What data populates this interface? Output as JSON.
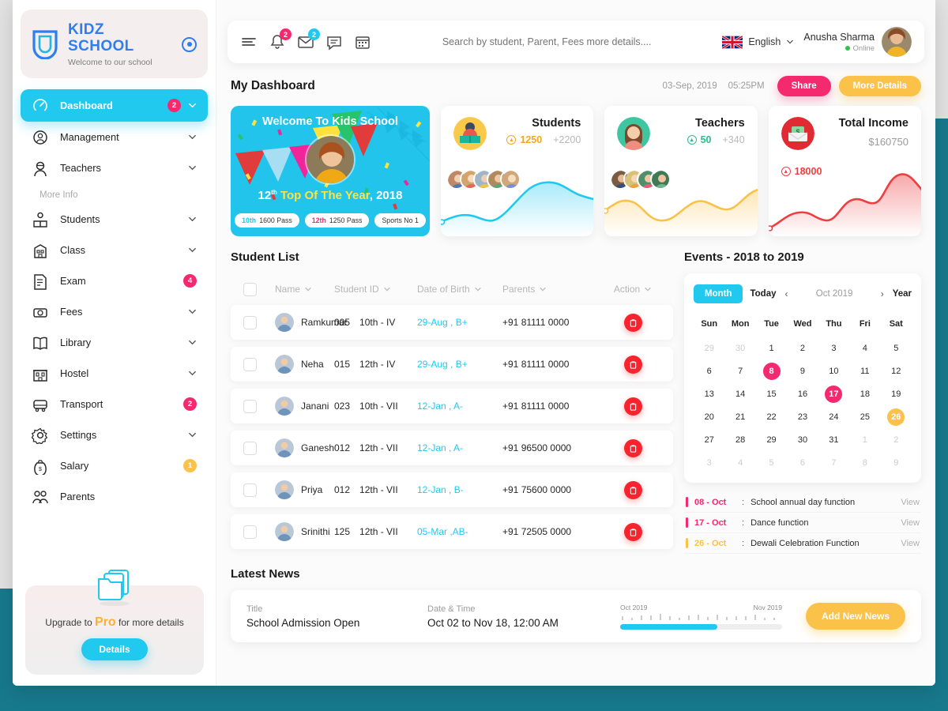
{
  "brand": {
    "title": "KIDZ SCHOOL",
    "subtitle": "Welcome to our school"
  },
  "sidebar": {
    "section_label": "More Info",
    "items": [
      {
        "label": "Dashboard",
        "icon": "speedometer-icon",
        "badge": "2",
        "badge_color": "pink",
        "chevron": true,
        "active": true
      },
      {
        "label": "Management",
        "icon": "gear-user-icon",
        "badge": "",
        "badge_color": "",
        "chevron": true,
        "active": false
      },
      {
        "label": "Teachers",
        "icon": "teacher-icon",
        "badge": "",
        "badge_color": "",
        "chevron": true,
        "active": false
      },
      {
        "label": "Students",
        "icon": "student-icon",
        "badge": "",
        "badge_color": "",
        "chevron": true,
        "active": false
      },
      {
        "label": "Class",
        "icon": "school-icon",
        "badge": "",
        "badge_color": "",
        "chevron": true,
        "active": false
      },
      {
        "label": "Exam",
        "icon": "exam-paper-icon",
        "badge": "4",
        "badge_color": "pink",
        "chevron": false,
        "active": false
      },
      {
        "label": "Fees",
        "icon": "fees-icon",
        "badge": "",
        "badge_color": "",
        "chevron": true,
        "active": false
      },
      {
        "label": "Library",
        "icon": "book-icon",
        "badge": "",
        "badge_color": "",
        "chevron": true,
        "active": false
      },
      {
        "label": "Hostel",
        "icon": "hostel-icon",
        "badge": "",
        "badge_color": "",
        "chevron": true,
        "active": false
      },
      {
        "label": "Transport",
        "icon": "bus-icon",
        "badge": "2",
        "badge_color": "pink",
        "chevron": false,
        "active": false
      },
      {
        "label": "Settings",
        "icon": "gear-icon",
        "badge": "",
        "badge_color": "",
        "chevron": true,
        "active": false
      },
      {
        "label": "Salary",
        "icon": "money-bag-icon",
        "badge": "1",
        "badge_color": "yellow",
        "chevron": false,
        "active": false
      },
      {
        "label": "Parents",
        "icon": "parents-icon",
        "badge": "",
        "badge_color": "",
        "chevron": false,
        "active": false
      }
    ],
    "promo": {
      "icon": "folder-documents-icon",
      "text_before": "Upgrade to ",
      "highlight": "Pro",
      "text_after": " for more details",
      "button": "Details"
    }
  },
  "topbar": {
    "icons": [
      {
        "name": "hamburger-menu-icon",
        "badge": "",
        "badge_color": ""
      },
      {
        "name": "bell-icon",
        "badge": "2",
        "badge_color": "pink"
      },
      {
        "name": "envelope-icon",
        "badge": "2",
        "badge_color": "cyan"
      },
      {
        "name": "chat-icon",
        "badge": "",
        "badge_color": ""
      },
      {
        "name": "calendar-icon",
        "badge": "",
        "badge_color": ""
      }
    ],
    "search": {
      "placeholder": "Search by student, Parent, Fees more details....",
      "value": ""
    },
    "language": {
      "label": "English",
      "flag": "uk-flag-icon"
    },
    "user": {
      "name": "Anusha Sharma",
      "status": "Online"
    }
  },
  "dashboard_header": {
    "title": "My Dashboard",
    "date": "03-Sep, 2019",
    "time": "05:25PM",
    "share_label": "Share",
    "more_label": "More Details"
  },
  "banner": {
    "title": "Welcome To Kids School",
    "rank": "12",
    "rank_sup": "th",
    "year_text": "Top Of The Year",
    "year": ", 2018",
    "pills": [
      {
        "tag": "10th",
        "text": "1600 Pass",
        "color": "cyan"
      },
      {
        "tag": "12th",
        "text": "1250 Pass",
        "color": "pink"
      },
      {
        "tag": "",
        "text": "Sports No 1",
        "color": ""
      }
    ]
  },
  "stats": [
    {
      "name": "Students",
      "value": "1250",
      "change": "+2200",
      "value_color": "#f5a623",
      "accent": "#22c9ef",
      "icon": "student-reading-icon"
    },
    {
      "name": "Teachers",
      "value": "50",
      "change": "+340",
      "value_color": "#2bbd8c",
      "accent": "#fbc24a",
      "icon": "teacher-woman-icon"
    }
  ],
  "income": {
    "name": "Total Income",
    "amount": "$160750",
    "value": "18000",
    "accent": "#ef3e42",
    "icon": "money-envelope-icon"
  },
  "student_list": {
    "title": "Student List",
    "columns": [
      "Name",
      "Student ID",
      "Date of Birth",
      "Parents",
      "Action"
    ],
    "rows": [
      {
        "name": "Ramkumar",
        "id": "005",
        "class": "10th - IV",
        "dob": "29-Aug , B+",
        "parents": "+91 81111 0000"
      },
      {
        "name": "Neha",
        "id": "015",
        "class": "12th - IV",
        "dob": "29-Aug , B+",
        "parents": "+91 81111 0000"
      },
      {
        "name": "Janani",
        "id": "023",
        "class": "10th - VII",
        "dob": "12-Jan , A-",
        "parents": "+91 81111 0000"
      },
      {
        "name": "Ganesh",
        "id": "012",
        "class": "12th - VII",
        "dob": "12-Jan , A-",
        "parents": "+91 96500 0000"
      },
      {
        "name": "Priya",
        "id": "012",
        "class": "12th - VII",
        "dob": "12-Jan , B-",
        "parents": "+91 75600 0000"
      },
      {
        "name": "Srinithi",
        "id": "125",
        "class": "12th - VII",
        "dob": "05-Mar ,AB-",
        "parents": "+91 72505 0000"
      }
    ]
  },
  "events_panel": {
    "title": "Events  - 2018 to 2019",
    "calendar": {
      "month_btn": "Month",
      "today_btn": "Today",
      "prev": "‹",
      "next": "›",
      "label": "Oct 2019",
      "year_btn": "Year",
      "dow": [
        "Sun",
        "Mon",
        "Tue",
        "Wed",
        "Thu",
        "Fri",
        "Sat"
      ],
      "weeks": [
        [
          {
            "d": "29",
            "s": "muted"
          },
          {
            "d": "30",
            "s": "muted"
          },
          {
            "d": "1",
            "s": ""
          },
          {
            "d": "2",
            "s": ""
          },
          {
            "d": "3",
            "s": ""
          },
          {
            "d": "4",
            "s": ""
          },
          {
            "d": "5",
            "s": ""
          }
        ],
        [
          {
            "d": "6",
            "s": ""
          },
          {
            "d": "7",
            "s": ""
          },
          {
            "d": "8",
            "s": "pink"
          },
          {
            "d": "9",
            "s": ""
          },
          {
            "d": "10",
            "s": ""
          },
          {
            "d": "11",
            "s": ""
          },
          {
            "d": "12",
            "s": ""
          }
        ],
        [
          {
            "d": "13",
            "s": ""
          },
          {
            "d": "14",
            "s": ""
          },
          {
            "d": "15",
            "s": ""
          },
          {
            "d": "16",
            "s": ""
          },
          {
            "d": "17",
            "s": "pink"
          },
          {
            "d": "18",
            "s": ""
          },
          {
            "d": "19",
            "s": ""
          }
        ],
        [
          {
            "d": "20",
            "s": ""
          },
          {
            "d": "21",
            "s": ""
          },
          {
            "d": "22",
            "s": ""
          },
          {
            "d": "23",
            "s": ""
          },
          {
            "d": "24",
            "s": ""
          },
          {
            "d": "25",
            "s": ""
          },
          {
            "d": "26",
            "s": "yellow"
          }
        ],
        [
          {
            "d": "27",
            "s": ""
          },
          {
            "d": "28",
            "s": ""
          },
          {
            "d": "29",
            "s": ""
          },
          {
            "d": "30",
            "s": ""
          },
          {
            "d": "31",
            "s": ""
          },
          {
            "d": "1",
            "s": "muted"
          },
          {
            "d": "2",
            "s": "muted"
          }
        ],
        [
          {
            "d": "3",
            "s": "muted"
          },
          {
            "d": "4",
            "s": "muted"
          },
          {
            "d": "5",
            "s": "muted"
          },
          {
            "d": "6",
            "s": "muted"
          },
          {
            "d": "7",
            "s": "muted"
          },
          {
            "d": "8",
            "s": "muted"
          },
          {
            "d": "9",
            "s": "muted"
          }
        ]
      ]
    },
    "events": [
      {
        "date": "08 - Oct",
        "name": "School annual day function",
        "view": "View",
        "color": "#f5296e"
      },
      {
        "date": "17 - Oct",
        "name": "Dance function",
        "view": "View",
        "color": "#f5296e"
      },
      {
        "date": "26 - Oct",
        "name": "Dewali Celebration Function",
        "view": "View",
        "color": "#fbc24a"
      }
    ]
  },
  "news": {
    "section_title": "Latest News",
    "title_label": "Title",
    "title_value": "School Admission Open",
    "date_label": "Date & Time",
    "date_value": "Oct 02 to Nov 18, 12:00 AM",
    "timeline_start": "Oct 2019",
    "timeline_end": "Nov 2019",
    "progress": 60,
    "button": "Add New News"
  }
}
